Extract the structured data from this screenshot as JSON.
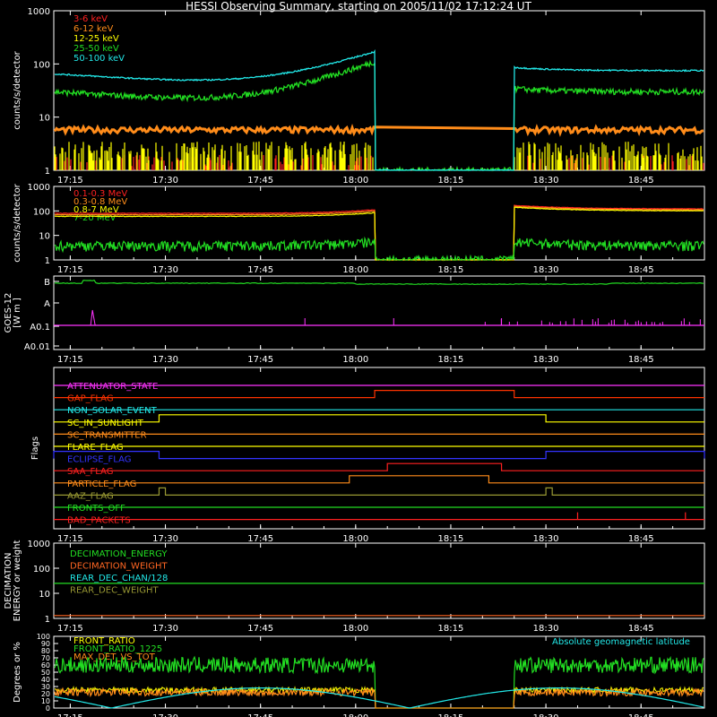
{
  "page": {
    "title": "HESSI Observing Summary, starting on 2005/11/02 17:12:24 UT"
  },
  "time_axis": {
    "range": [
      "17:12:24",
      "18:55:00"
    ],
    "tick_labels": [
      "17:15",
      "17:30",
      "17:45",
      "18:00",
      "18:15",
      "18:30",
      "18:45"
    ],
    "tick_minutes": [
      15,
      30,
      45,
      60,
      75,
      90,
      105
    ]
  },
  "colors": {
    "background": "#000000",
    "axes": "#ffffff",
    "red": "#ff2020",
    "orange": "#ff8c1a",
    "yellow": "#ffff00",
    "green": "#22dd22",
    "cyan": "#22e8e8",
    "magenta": "#ff33ff",
    "blue": "#3333ff",
    "olive": "#999933"
  },
  "chart_data": [
    {
      "type": "line",
      "ylabel": "counts/s/detector",
      "yscale": "log",
      "ylim": [
        1,
        1000
      ],
      "ytick_labels": [
        "1",
        "10",
        "100",
        "1000"
      ],
      "series": [
        {
          "name": "3-6 keV",
          "color": "#ff2020",
          "value_range": [
            1,
            2
          ]
        },
        {
          "name": "6-12 keV",
          "color": "#ff8c1a",
          "value_range": [
            5,
            6
          ]
        },
        {
          "name": "12-25 keV",
          "color": "#ffff00",
          "value_range": [
            1,
            4
          ]
        },
        {
          "name": "25-50 keV",
          "color": "#22dd22",
          "values_start": 30,
          "values_peak": 110,
          "values_after": 30
        },
        {
          "name": "50-100 keV",
          "color": "#22e8e8",
          "values_start": 65,
          "values_peak": 170,
          "values_after": 75
        }
      ],
      "gap": [
        "18:03",
        "18:25"
      ]
    },
    {
      "type": "line",
      "ylabel": "counts/s/detector",
      "yscale": "log",
      "ylim": [
        1,
        1000
      ],
      "ytick_labels": [
        "1",
        "10",
        "100",
        "1000"
      ],
      "series": [
        {
          "name": "0.1-0.3 MeV",
          "color": "#ff2020",
          "value_start": 80,
          "value_after": 120
        },
        {
          "name": "0.3-0.8 MeV",
          "color": "#ff8c1a",
          "value_start": 70,
          "value_after": 110
        },
        {
          "name": "0.8-7 MeV",
          "color": "#ffff00",
          "value_start": 60,
          "value_after": 100
        },
        {
          "name": "7-20 MeV",
          "color": "#22dd22",
          "value_start": 4,
          "value_after": 4
        }
      ],
      "gap": [
        "18:03",
        "18:25"
      ]
    },
    {
      "type": "line",
      "ylabel": "GOES-12 [W m⁻²]",
      "ylabel_lines": [
        "GOES-12",
        "[W m  ]"
      ],
      "ytick_labels": [
        "B",
        "A",
        "A0.1",
        "A0.01"
      ],
      "series": [
        {
          "color": "#22dd22",
          "level": "B"
        },
        {
          "color": "#ff33ff",
          "level": "A0.1"
        }
      ]
    },
    {
      "type": "line",
      "ylabel": "Flags",
      "flags": [
        {
          "name": "ATTENUATOR_STATE",
          "color": "#ff33ff",
          "on": []
        },
        {
          "name": "GAP_FLAG",
          "color": "#ff3300",
          "on": [
            [
              "18:03",
              "18:25"
            ]
          ]
        },
        {
          "name": "NON_SOLAR_EVENT",
          "color": "#22e8e8",
          "on": []
        },
        {
          "name": "SC_IN_SUNLIGHT",
          "color": "#ffff00",
          "on": [
            [
              "17:29",
              "18:30"
            ]
          ]
        },
        {
          "name": "SC_TRANSMITTER",
          "color": "#ff8c1a",
          "on": []
        },
        {
          "name": "FLARE_FLAG",
          "color": "#ffff00",
          "on": []
        },
        {
          "name": "ECLIPSE_FLAG",
          "color": "#3333ff",
          "on": [
            [
              "17:12",
              "17:29"
            ],
            [
              "18:30",
              "18:55"
            ]
          ]
        },
        {
          "name": "SAA_FLAG",
          "color": "#ff2020",
          "on": [
            [
              "18:05",
              "18:23"
            ]
          ]
        },
        {
          "name": "PARTICLE_FLAG",
          "color": "#ff8c1a",
          "on": [
            [
              "17:59",
              "18:21"
            ]
          ]
        },
        {
          "name": "AAZ_FLAG",
          "color": "#999933",
          "on": [
            [
              "17:29",
              "17:30"
            ],
            [
              "18:30",
              "18:31"
            ]
          ]
        },
        {
          "name": "FRONTS_OFF",
          "color": "#22dd22",
          "on": []
        },
        {
          "name": "BAD_PACKETS",
          "color": "#ff2020",
          "on": [
            [
              "18:35",
              "18:35"
            ],
            [
              "18:52",
              "18:52"
            ]
          ]
        }
      ]
    },
    {
      "type": "line",
      "ylabel": "DECIMATION ENERGY or weight",
      "ylabel_lines": [
        "DECIMATION",
        "ENERGY or weight"
      ],
      "yscale": "log",
      "ylim": [
        1,
        1000
      ],
      "ytick_labels": [
        "1",
        "10",
        "100",
        "1000"
      ],
      "series": [
        {
          "name": "DECIMATION_ENERGY",
          "color": "#22dd22",
          "value": 25
        },
        {
          "name": "DECIMATION_WEIGHT",
          "color": "#ff6622",
          "value": 1.3
        },
        {
          "name": "REAR_DEC_CHAN/128",
          "color": "#22e8e8",
          "value": 0
        },
        {
          "name": "REAR_DEC_WEIGHT",
          "color": "#999933",
          "value": 0
        }
      ]
    },
    {
      "type": "line",
      "ylabel": "Degrees or %",
      "ylim": [
        0,
        100
      ],
      "ytick_labels": [
        "0",
        "10",
        "20",
        "30",
        "40",
        "50",
        "60",
        "70",
        "80",
        "90",
        "100"
      ],
      "series": [
        {
          "name": "FRONT_RATIO",
          "color": "#ffff00",
          "value_level": 25
        },
        {
          "name": "FRONT_RATIO_1225",
          "color": "#22dd22",
          "value_level": 60
        },
        {
          "name": "MAX_DET_VS_TOT",
          "color": "#ff8c1a",
          "value_level": 22
        }
      ],
      "annotation": "Absolute geomagnetic latitude",
      "annotation_color": "#22e8e8"
    }
  ]
}
